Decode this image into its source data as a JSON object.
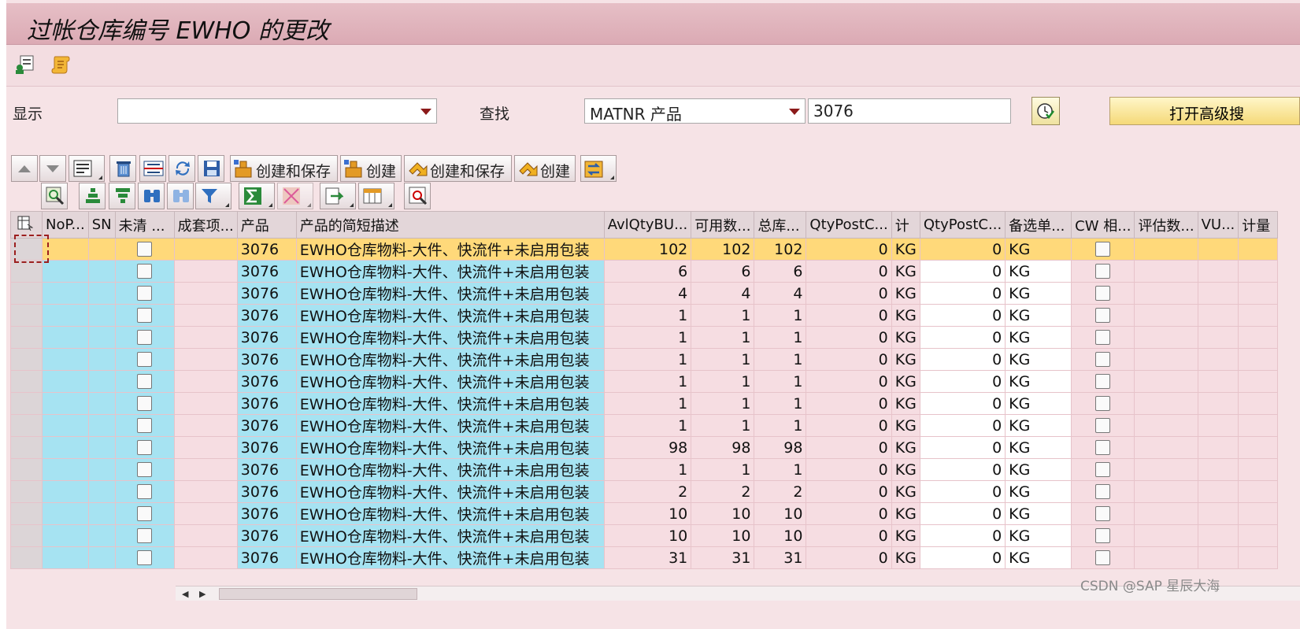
{
  "window": {
    "title": "过帐仓库编号 EWHO 的更改"
  },
  "filter": {
    "display_label": "显示",
    "display_value": "",
    "search_label": "查找",
    "search_field_value": "MATNR 产品",
    "search_value": "3076",
    "advanced_button": "打开高级搜"
  },
  "toolbar": {
    "create_save_1": "创建和保存",
    "create_1": "创建",
    "create_save_2": "创建和保存",
    "create_2": "创建"
  },
  "grid": {
    "columns": [
      "NoP...",
      "SN",
      "未清 ...",
      "成套项...",
      "产品",
      "产品的简短描述",
      "AvlQtyBU...",
      "可用数...",
      "总库...",
      "QtyPostC...",
      "计",
      "QtyPostC...",
      "备选单...",
      "CW 相...",
      "评估数...",
      "VU...",
      "计量"
    ],
    "rows": [
      {
        "product": "3076",
        "desc": "EWHO仓库物料-大件、快流件+未启用包装",
        "avl": "102",
        "avail": "102",
        "total": "102",
        "qp1": "0",
        "unit": "KG",
        "qp2": "0",
        "alt": "KG"
      },
      {
        "product": "3076",
        "desc": "EWHO仓库物料-大件、快流件+未启用包装",
        "avl": "6",
        "avail": "6",
        "total": "6",
        "qp1": "0",
        "unit": "KG",
        "qp2": "0",
        "alt": "KG"
      },
      {
        "product": "3076",
        "desc": "EWHO仓库物料-大件、快流件+未启用包装",
        "avl": "4",
        "avail": "4",
        "total": "4",
        "qp1": "0",
        "unit": "KG",
        "qp2": "0",
        "alt": "KG"
      },
      {
        "product": "3076",
        "desc": "EWHO仓库物料-大件、快流件+未启用包装",
        "avl": "1",
        "avail": "1",
        "total": "1",
        "qp1": "0",
        "unit": "KG",
        "qp2": "0",
        "alt": "KG"
      },
      {
        "product": "3076",
        "desc": "EWHO仓库物料-大件、快流件+未启用包装",
        "avl": "1",
        "avail": "1",
        "total": "1",
        "qp1": "0",
        "unit": "KG",
        "qp2": "0",
        "alt": "KG"
      },
      {
        "product": "3076",
        "desc": "EWHO仓库物料-大件、快流件+未启用包装",
        "avl": "1",
        "avail": "1",
        "total": "1",
        "qp1": "0",
        "unit": "KG",
        "qp2": "0",
        "alt": "KG"
      },
      {
        "product": "3076",
        "desc": "EWHO仓库物料-大件、快流件+未启用包装",
        "avl": "1",
        "avail": "1",
        "total": "1",
        "qp1": "0",
        "unit": "KG",
        "qp2": "0",
        "alt": "KG"
      },
      {
        "product": "3076",
        "desc": "EWHO仓库物料-大件、快流件+未启用包装",
        "avl": "1",
        "avail": "1",
        "total": "1",
        "qp1": "0",
        "unit": "KG",
        "qp2": "0",
        "alt": "KG"
      },
      {
        "product": "3076",
        "desc": "EWHO仓库物料-大件、快流件+未启用包装",
        "avl": "1",
        "avail": "1",
        "total": "1",
        "qp1": "0",
        "unit": "KG",
        "qp2": "0",
        "alt": "KG"
      },
      {
        "product": "3076",
        "desc": "EWHO仓库物料-大件、快流件+未启用包装",
        "avl": "98",
        "avail": "98",
        "total": "98",
        "qp1": "0",
        "unit": "KG",
        "qp2": "0",
        "alt": "KG"
      },
      {
        "product": "3076",
        "desc": "EWHO仓库物料-大件、快流件+未启用包装",
        "avl": "1",
        "avail": "1",
        "total": "1",
        "qp1": "0",
        "unit": "KG",
        "qp2": "0",
        "alt": "KG"
      },
      {
        "product": "3076",
        "desc": "EWHO仓库物料-大件、快流件+未启用包装",
        "avl": "2",
        "avail": "2",
        "total": "2",
        "qp1": "0",
        "unit": "KG",
        "qp2": "0",
        "alt": "KG"
      },
      {
        "product": "3076",
        "desc": "EWHO仓库物料-大件、快流件+未启用包装",
        "avl": "10",
        "avail": "10",
        "total": "10",
        "qp1": "0",
        "unit": "KG",
        "qp2": "0",
        "alt": "KG"
      },
      {
        "product": "3076",
        "desc": "EWHO仓库物料-大件、快流件+未启用包装",
        "avl": "10",
        "avail": "10",
        "total": "10",
        "qp1": "0",
        "unit": "KG",
        "qp2": "0",
        "alt": "KG"
      },
      {
        "product": "3076",
        "desc": "EWHO仓库物料-大件、快流件+未启用包装",
        "avl": "31",
        "avail": "31",
        "total": "31",
        "qp1": "0",
        "unit": "KG",
        "qp2": "0",
        "alt": "KG"
      }
    ]
  },
  "watermark": "CSDN @SAP 星辰大海",
  "colors": {
    "accent": "#ffd97a",
    "key_column": "#a6e3f2",
    "background": "#f6e3e6"
  }
}
